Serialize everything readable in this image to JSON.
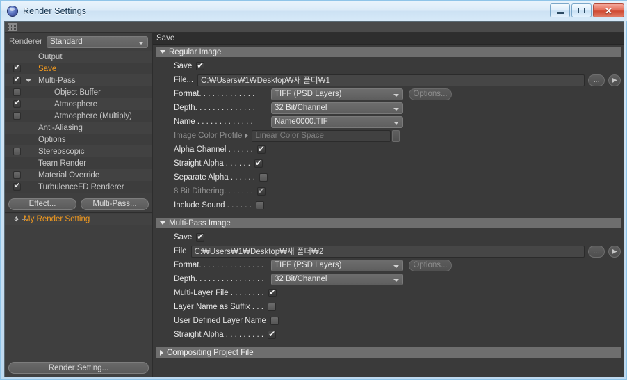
{
  "window": {
    "title": "Render Settings",
    "icon": "c4d-logo-icon",
    "minimize_label": "",
    "maximize_label": "",
    "close_label": "✕"
  },
  "sidebar": {
    "renderer_label": "Renderer",
    "renderer_value": "Standard",
    "tree": [
      {
        "label": "Output",
        "checkbox": "none",
        "indent": 1,
        "selected": false,
        "expander": "none"
      },
      {
        "label": "Save",
        "checkbox": "on",
        "indent": 1,
        "selected": true,
        "expander": "none"
      },
      {
        "label": "Multi-Pass",
        "checkbox": "on",
        "indent": 1,
        "selected": false,
        "expander": "down"
      },
      {
        "label": "Object Buffer",
        "checkbox": "off",
        "indent": 2,
        "selected": false,
        "expander": "none"
      },
      {
        "label": "Atmosphere",
        "checkbox": "on",
        "indent": 2,
        "selected": false,
        "expander": "none"
      },
      {
        "label": "Atmosphere (Multiply)",
        "checkbox": "off",
        "indent": 2,
        "selected": false,
        "expander": "none"
      },
      {
        "label": "Anti-Aliasing",
        "checkbox": "none",
        "indent": 1,
        "selected": false,
        "expander": "none"
      },
      {
        "label": "Options",
        "checkbox": "none",
        "indent": 1,
        "selected": false,
        "expander": "none"
      },
      {
        "label": "Stereoscopic",
        "checkbox": "off",
        "indent": 1,
        "selected": false,
        "expander": "none"
      },
      {
        "label": "Team Render",
        "checkbox": "none",
        "indent": 1,
        "selected": false,
        "expander": "none"
      },
      {
        "label": "Material Override",
        "checkbox": "off",
        "indent": 1,
        "selected": false,
        "expander": "none"
      },
      {
        "label": "TurbulenceFD Renderer",
        "checkbox": "on",
        "indent": 1,
        "selected": false,
        "expander": "none"
      }
    ],
    "effect_button": "Effect...",
    "multipass_button": "Multi-Pass...",
    "render_setting_name": "My Render Setting",
    "render_setting_button": "Render Setting..."
  },
  "panel": {
    "breadcrumb": "Save",
    "groups": [
      {
        "title": "Regular Image",
        "collapsed": false,
        "rows": [
          {
            "kind": "check",
            "label": "Save",
            "value": "on"
          },
          {
            "kind": "file",
            "label": "File...",
            "value": "C:₩Users₩1₩Desktop₩새 폴더₩1"
          },
          {
            "kind": "select",
            "label": "Format. . . . . . . . . . . . .",
            "value": "TIFF (PSD Layers)",
            "options_button": "Options..."
          },
          {
            "kind": "select",
            "label": "Depth. . . . . . . . . . . . . .",
            "value": "32 Bit/Channel"
          },
          {
            "kind": "select",
            "label": "Name . . . . . . . . . . . . .",
            "value": "Name0000.TIF"
          },
          {
            "kind": "subfield",
            "label": "Image Color Profile",
            "value": "Linear Color Space",
            "dim": true
          },
          {
            "kind": "check",
            "label": "Alpha Channel . . . . . .",
            "value": "on"
          },
          {
            "kind": "check",
            "label": "Straight Alpha . . . . . .",
            "value": "on"
          },
          {
            "kind": "check",
            "label": "Separate Alpha . . . . . .",
            "value": "off"
          },
          {
            "kind": "check",
            "label": "8 Bit Dithering. . . . . . .",
            "value": "on",
            "dim": true
          },
          {
            "kind": "check",
            "label": "Include Sound  . . . . . .",
            "value": "off"
          }
        ]
      },
      {
        "title": "Multi-Pass Image",
        "collapsed": false,
        "rows": [
          {
            "kind": "check",
            "label": "Save",
            "value": "on"
          },
          {
            "kind": "file",
            "label": "File",
            "value": "C:₩Users₩1₩Desktop₩새 폴더₩2"
          },
          {
            "kind": "select",
            "label": "Format. . . . . . . . . . . . . . .",
            "value": "TIFF (PSD Layers)",
            "options_button": "Options..."
          },
          {
            "kind": "select",
            "label": "Depth. . . . . . . . . . . . . . . .",
            "value": "32 Bit/Channel"
          },
          {
            "kind": "check",
            "label": "Multi-Layer File . . . . . . . .",
            "value": "on"
          },
          {
            "kind": "check",
            "label": "Layer Name as Suffix . . .",
            "value": "off"
          },
          {
            "kind": "check",
            "label": "User Defined Layer Name",
            "value": "off"
          },
          {
            "kind": "check",
            "label": "Straight Alpha . . . . . . . . .",
            "value": "on"
          }
        ]
      },
      {
        "title": "Compositing Project File",
        "collapsed": true,
        "rows": []
      }
    ],
    "browse_button": "...",
    "arrow_button": "▶"
  },
  "colors": {
    "accent_orange": "#f29a1f",
    "panel_bg": "#3a3a3a",
    "group_head": "#6e6e6e",
    "aero_border": "#8fc4e8"
  }
}
